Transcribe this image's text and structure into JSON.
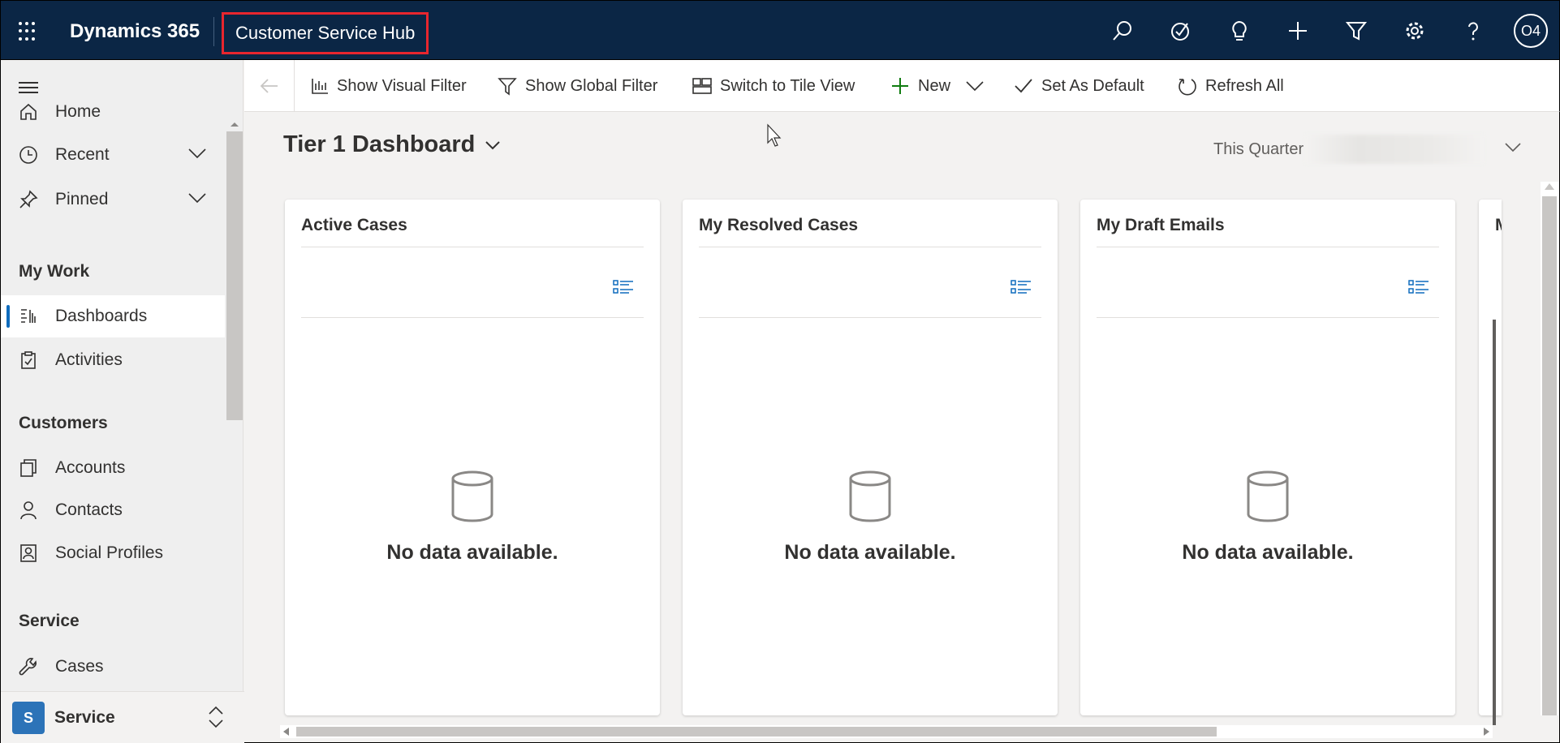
{
  "topbar": {
    "brand": "Dynamics 365",
    "app_title": "Customer Service Hub",
    "icons": [
      "search-icon",
      "assistant-icon",
      "lightbulb-icon",
      "add-icon",
      "filter-icon",
      "settings-icon",
      "help-icon"
    ],
    "avatar_initials": "O4",
    "highlight_color": "#e8262e",
    "bg_color": "#0b2645"
  },
  "sidebar": {
    "items_top": [
      {
        "label": "Home",
        "icon": "home-icon"
      },
      {
        "label": "Recent",
        "icon": "clock-icon"
      },
      {
        "label": "Pinned",
        "icon": "pin-icon"
      }
    ],
    "groups": {
      "my_work": "My Work",
      "customers": "Customers",
      "service": "Service"
    },
    "my_work_items": [
      {
        "label": "Dashboards",
        "icon": "dashboard-icon",
        "active": true
      },
      {
        "label": "Activities",
        "icon": "clipboard-icon",
        "active": false
      }
    ],
    "customer_items": [
      {
        "label": "Accounts",
        "icon": "accounts-icon"
      },
      {
        "label": "Contacts",
        "icon": "person-icon"
      },
      {
        "label": "Social Profiles",
        "icon": "social-profile-icon"
      }
    ],
    "service_items": [
      {
        "label": "Cases",
        "icon": "wrench-icon"
      }
    ],
    "area": {
      "badge": "S",
      "label": "Service"
    }
  },
  "cmdbar": {
    "show_visual_filter": "Show Visual Filter",
    "show_global_filter": "Show Global Filter",
    "switch_tile_view": "Switch to Tile View",
    "new": "New",
    "set_default": "Set As Default",
    "refresh_all": "Refresh All"
  },
  "dashboard": {
    "title": "Tier 1 Dashboard",
    "period": "This Quarter",
    "cards": [
      {
        "title": "Active Cases",
        "empty_text": "No data available."
      },
      {
        "title": "My Resolved Cases",
        "empty_text": "No data available."
      },
      {
        "title": "My Draft Emails",
        "empty_text": "No data available."
      },
      {
        "title": "M",
        "empty_text": ""
      }
    ]
  }
}
